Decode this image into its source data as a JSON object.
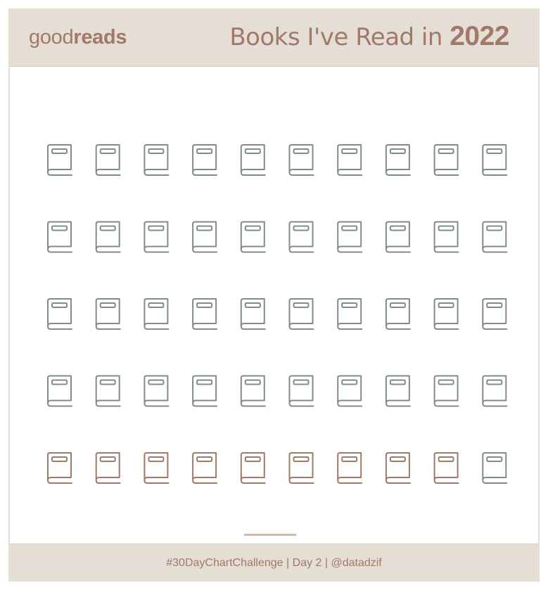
{
  "header": {
    "logo_light": "good",
    "logo_bold": "reads",
    "title_text": "Books I've Read in ",
    "title_year": "2022"
  },
  "footer": {
    "caption": "#30DayChartChallenge | Day 2 | @datadzif"
  },
  "colors": {
    "background": "#ffffff",
    "band": "#e5ded5",
    "brand": "#a0796a",
    "unread": "#7f8c8d",
    "read": "#a0796a",
    "divider": "#d6b89b"
  },
  "chart_data": {
    "type": "pictogram",
    "icon": "book-icon",
    "rows": 5,
    "columns": 10,
    "total": 50,
    "read": 9,
    "fill_order": "bottom-left to right",
    "title": "Books I've Read in 2022"
  }
}
